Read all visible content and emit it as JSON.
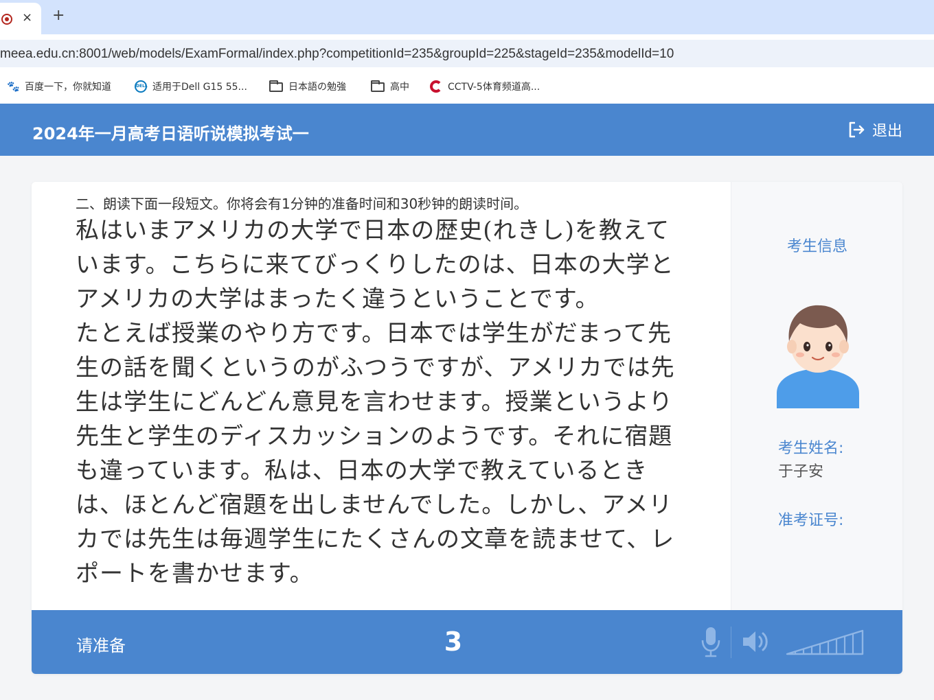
{
  "browser": {
    "tab_close": "×",
    "new_tab": "+",
    "url": "meea.edu.cn:8001/web/models/ExamFormal/index.php?competitionId=235&groupId=225&stageId=235&modelId=10",
    "bookmarks": [
      {
        "icon": "baidu-paw-icon",
        "label": "百度一下，你就知道"
      },
      {
        "icon": "dell-icon",
        "label": "适用于Dell G15 55..."
      },
      {
        "icon": "folder-icon",
        "label": "日本語の勉強"
      },
      {
        "icon": "folder-icon",
        "label": "高中"
      },
      {
        "icon": "cctv-icon",
        "label": "CCTV-5体育频道高..."
      }
    ]
  },
  "header": {
    "title": "2024年一月高考日语听说模拟考试一",
    "logout_label": "退出",
    "color": "#4a86cf"
  },
  "main": {
    "instruction": "二、朗读下面一段短文。你将会有1分钟的准备时间和30秒钟的朗读时间。",
    "passage": "私はいまアメリカの大学で日本の歴史(れきし)を教えています。こちらに来てびっくりしたのは、日本の大学とアメリカの大学はまったく違うということです。\nたとえば授業のやり方です。日本では学生がだまって先生の話を聞くというのがふつうですが、アメリカでは先生は学生にどんどん意見を言わせます。授業というより先生と学生のディスカッションのようです。それに宿題も違っています。私は、日本の大学で教えているときは、ほとんど宿題を出しませんでした。しかし、アメリカでは先生は毎週学生にたくさんの文章を読ませて、レポートを書かせます。"
  },
  "sidebar": {
    "title": "考生信息",
    "name_label": "考生姓名:",
    "name_value": "于子安",
    "id_label": "准考证号:",
    "id_value": ""
  },
  "footer": {
    "status": "请准备",
    "countdown": "3",
    "icons": [
      "microphone-icon",
      "speaker-icon",
      "volume-level-icon"
    ]
  }
}
